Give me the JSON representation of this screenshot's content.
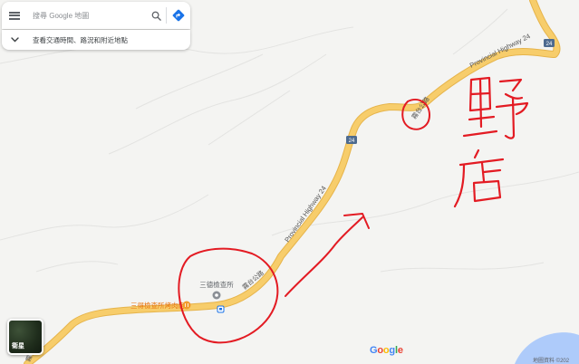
{
  "search": {
    "placeholder": "搜尋 Google 地圖",
    "value": ""
  },
  "traffic": {
    "label": "查看交通時間、路況和附近地點"
  },
  "map": {
    "road_labels": {
      "provincial_highway_upper": "Provincial Highway 24",
      "provincial_highway_middle": "Provincial Highway 24",
      "wutai_road_upper": "霧台公路",
      "wutai_road_lower": "霧台公路",
      "shield_24_right": "24",
      "shield_24_middle": "24",
      "left_edge_fragment": "霧"
    },
    "places": {
      "checkpoint": "三德檢查所",
      "restaurant": "三得檢查所烤肉店"
    },
    "annotations": {
      "handwritten_text": "野店"
    },
    "colors": {
      "road": "#f7cd6b",
      "road_edge": "#e6b44b",
      "water": "#aecbfa",
      "ink": "#e31b23",
      "poi_orange": "#f29b2c",
      "bus_blue": "#1a73e8"
    }
  },
  "satellite": {
    "label": "衛星"
  },
  "footer": {
    "google_letters": [
      "G",
      "o",
      "o",
      "g",
      "l",
      "e"
    ],
    "map_data": "地圖資料 ©202"
  }
}
